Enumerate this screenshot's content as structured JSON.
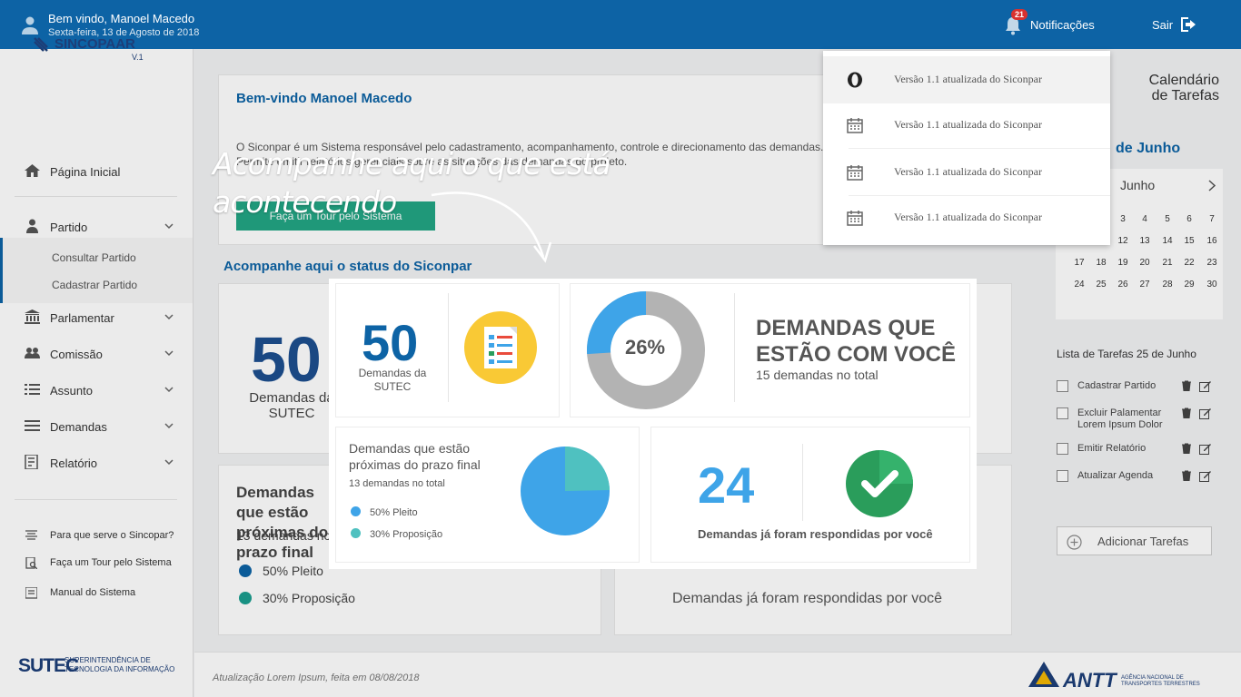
{
  "header": {
    "welcome": "Bem vindo, Manoel Macedo",
    "date": "Sexta-feira, 13 de Agosto de 2018",
    "notif_count": "21",
    "notif_label": "Notificações",
    "exit_label": "Sair"
  },
  "sidebar": {
    "logo": "SINCOPAAR",
    "version": "V.1",
    "items": [
      {
        "label": "Página Inicial",
        "icon": "home-icon"
      },
      {
        "label": "Partido",
        "icon": "user-icon"
      },
      {
        "label": "Parlamentar",
        "icon": "building-icon"
      },
      {
        "label": "Comissão",
        "icon": "group-icon"
      },
      {
        "label": "Assunto",
        "icon": "list-icon"
      },
      {
        "label": "Demandas",
        "icon": "list-icon"
      },
      {
        "label": "Relatório",
        "icon": "report-icon"
      }
    ],
    "sub_items": [
      "Consultar Partido",
      "Cadastrar Partido"
    ],
    "help": [
      "Para que serve o Sincopar?",
      "Faça um Tour pelo Sistema",
      "Manual do Sistema"
    ],
    "sutec": "SUTEC",
    "sutec_sub": "SUPERINTENDÊNCIA DE TECNOLOGIA DA INFORMAÇÃO"
  },
  "main": {
    "welcome_title": "Bem-vindo Manoel Macedo",
    "intro": "O Siconpar é um Sistema responsável pelo cadastramento, acompanhamento, controle e direcionamento das demandas... Permite emitir relatórios gerenciais sobre as situações das demandas do projeto.",
    "tour_button": "Faça um Tour pelo Sistema",
    "status_title": "Acompanhe aqui o status do Siconpar",
    "bg_prox": "Demandas que estão próximas do prazo final",
    "bg_13": "13 demandas no total",
    "bg_resp": "Demandas já foram respondidas por você",
    "footer_update": "Atualização Lorem Ipsum, feita em 08/08/2018"
  },
  "notifications": [
    "Versão 1.1 atualizada do Siconpar",
    "Versão 1.1 atualizada do Siconpar",
    "Versão 1.1 atualizada do Siconpar",
    "Versão 1.1 atualizada do Siconpar"
  ],
  "calendar": {
    "title_line1": "Calendário",
    "title_line2": "de Tarefas",
    "month_heading": "de Junho",
    "month_select": "Junho",
    "days": [
      "3",
      "4",
      "5",
      "6",
      "7",
      "10",
      "11",
      "12",
      "13",
      "14",
      "15",
      "16",
      "17",
      "18",
      "19",
      "20",
      "21",
      "22",
      "23",
      "24",
      "25",
      "26",
      "27",
      "28",
      "29",
      "30"
    ]
  },
  "tasks": {
    "title": "Lista de Tarefas 25 de Junho",
    "items": [
      "Cadastrar Partido",
      "Excluir Palamentar Lorem Ipsum Dolor",
      "Emitir Relatório",
      "Atualizar Agenda"
    ],
    "add_label": "Adicionar Tarefas"
  },
  "tour": {
    "callout_line1": "Acompanhe aqui o que está",
    "callout_line2": "acontecendo"
  },
  "highlight": {
    "sutec_count": "50",
    "sutec_label": "Demandas da SUTEC",
    "donut_percent": "26%",
    "donut_fraction": 0.26,
    "with_you_title": "DEMANDAS QUE ESTÃO COM VOCÊ",
    "with_you_sub": "15 demandas no total",
    "prox_title": "Demandas que estão próximas do prazo final",
    "prox_count": "13  demandas no total",
    "legend": [
      "50% Pleito",
      "30% Proposição"
    ],
    "answered_count": "24",
    "answered_label": "Demandas já foram respondidas por você"
  },
  "colors": {
    "primary": "#0d63a5",
    "accent_blue": "#3ea4e8",
    "teal": "#4fc1c0",
    "green": "#22a584",
    "gray": "#b3b3b3"
  },
  "footer": {
    "antt": "ANTT",
    "antt_sub": "AGÊNCIA NACIONAL DE TRANSPORTES TERRESTRES"
  }
}
